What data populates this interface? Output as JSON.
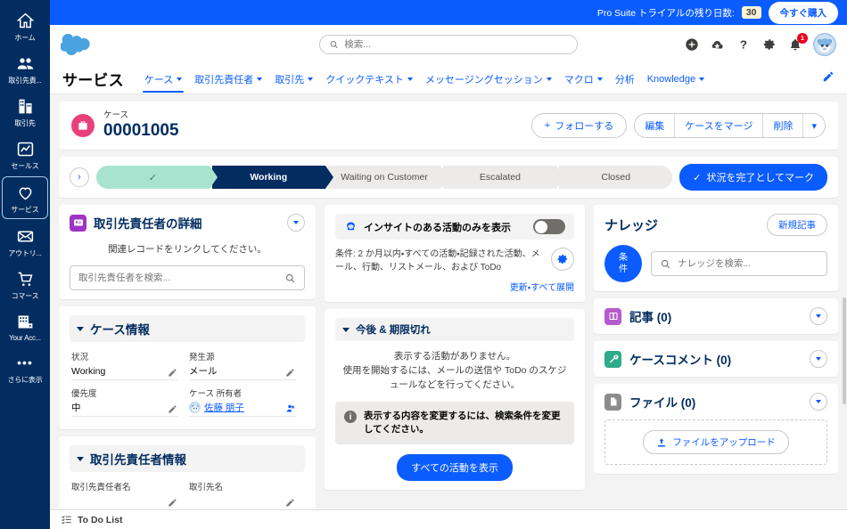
{
  "trial": {
    "message": "Pro Suite トライアルの残り日数:",
    "days": "30",
    "buy_label": "今すぐ購入"
  },
  "global_header": {
    "search_placeholder": "検索...",
    "search_value": "",
    "notification_count": "1",
    "icons": [
      "plus-icon",
      "cloud-favorites-icon",
      "help-icon",
      "gear-icon",
      "bell-icon",
      "avatar"
    ]
  },
  "app_nav": {
    "app_name": "サービス",
    "tabs": [
      {
        "label": "ケース",
        "has_caret": true,
        "active": true
      },
      {
        "label": "取引先責任者",
        "has_caret": true,
        "active": false
      },
      {
        "label": "取引先",
        "has_caret": true,
        "active": false
      },
      {
        "label": "クイックテキスト",
        "has_caret": true,
        "active": false
      },
      {
        "label": "メッセージングセッション",
        "has_caret": true,
        "active": false
      },
      {
        "label": "マクロ",
        "has_caret": true,
        "active": false
      },
      {
        "label": "分析",
        "has_caret": false,
        "active": false
      },
      {
        "label": "Knowledge",
        "has_caret": true,
        "active": false
      }
    ]
  },
  "sidebar": {
    "items": [
      {
        "label": "ホーム",
        "icon": "home-icon",
        "active": false
      },
      {
        "label": "取引先責...",
        "icon": "contacts-icon",
        "active": false
      },
      {
        "label": "取引先",
        "icon": "accounts-icon",
        "active": false
      },
      {
        "label": "セールス",
        "icon": "sales-icon",
        "active": false
      },
      {
        "label": "サービス",
        "icon": "service-heart-icon",
        "active": true
      },
      {
        "label": "アウトリ...",
        "icon": "outreach-envelope-icon",
        "active": false
      },
      {
        "label": "コマース",
        "icon": "commerce-cart-icon",
        "active": false
      },
      {
        "label": "Your Acc...",
        "icon": "your-account-icon",
        "active": false
      },
      {
        "label": "さらに表示",
        "icon": "more-dots-icon",
        "active": false
      }
    ]
  },
  "record_header": {
    "object_label": "ケース",
    "record_name": "00001005",
    "follow_label": "フォローする",
    "actions": [
      "編集",
      "ケースをマージ",
      "削除"
    ]
  },
  "path": {
    "steps": [
      {
        "label": "",
        "state": "done"
      },
      {
        "label": "Working",
        "state": "current"
      },
      {
        "label": "Waiting on Customer",
        "state": "upcoming"
      },
      {
        "label": "Escalated",
        "state": "upcoming"
      },
      {
        "label": "Closed",
        "state": "upcoming"
      }
    ],
    "mark_complete_label": "状況を完了としてマーク"
  },
  "contact_details": {
    "title": "取引先責任者の詳細",
    "hint": "関連レコードをリンクしてください。",
    "search_placeholder": "取引先責任者を検索...",
    "search_value": ""
  },
  "case_info": {
    "title": "ケース情報",
    "fields": [
      {
        "label": "状況",
        "value": "Working",
        "type": "text"
      },
      {
        "label": "発生源",
        "value": "メール",
        "type": "text"
      },
      {
        "label": "優先度",
        "value": "中",
        "type": "text"
      },
      {
        "label": "ケース 所有者",
        "value": "佐藤 朋子",
        "type": "link"
      }
    ]
  },
  "contact_info": {
    "title": "取引先責任者情報",
    "fields": [
      {
        "label": "取引先責任者名",
        "value": ""
      },
      {
        "label": "取引先名",
        "value": ""
      }
    ]
  },
  "activity": {
    "insights_toggle_label": "インサイトのある活動のみを表示",
    "insights_toggle_on": false,
    "filter_text": "条件: 2 か月以内・すべての活動・記録された活動、メール、行動、リストメール、および ToDo",
    "refresh_link": "更新",
    "expand_all_link": "すべて展開",
    "link_separator": "・",
    "section_title": "今後 & 期限切れ",
    "empty_line1": "表示する活動がありません。",
    "empty_line2": "使用を開始するには、メールの送信や ToDo のスケジュールなどを行ってください。",
    "info_message": "表示する内容を変更するには、検索条件を変更してください。",
    "show_all_label": "すべての活動を表示"
  },
  "knowledge": {
    "title": "ナレッジ",
    "new_article_label": "新規記事",
    "filter_label_line1": "条",
    "filter_label_line2": "件",
    "search_placeholder": "ナレッジを検索...",
    "search_value": ""
  },
  "related_lists": [
    {
      "title": "記事 (0)",
      "icon": "article-icon",
      "color": "#b65bcc"
    },
    {
      "title": "ケースコメント (0)",
      "icon": "case-comment-wrench-icon",
      "color": "#2eab8b"
    },
    {
      "title": "ファイル (0)",
      "icon": "file-icon",
      "color": "#8c8c8c"
    }
  ],
  "files": {
    "upload_label": "ファイルをアップロード"
  },
  "utility_bar": {
    "todo_label": "To Do List"
  },
  "colors": {
    "brand_blue": "#0b5cff",
    "navy": "#032d60",
    "case_pink": "#e9407c",
    "path_done_green": "#a8e3d0",
    "badge_red": "#ea001e",
    "trial_badge": "#fdf4d3"
  }
}
